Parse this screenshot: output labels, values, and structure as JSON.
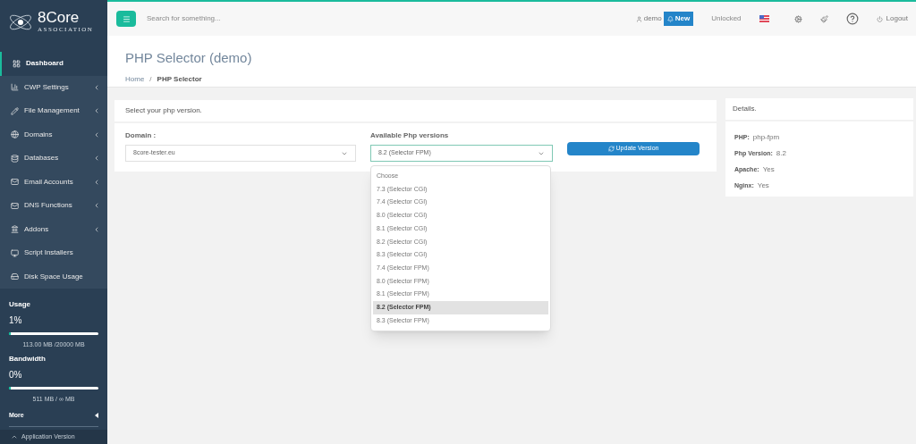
{
  "logo": {
    "name": "8Core",
    "subtitle": "ASSOCIATION"
  },
  "sidebar": {
    "items": [
      {
        "label": "Dashboard",
        "selected": true,
        "submenu": false
      },
      {
        "label": "CWP Settings",
        "selected": false,
        "submenu": true
      },
      {
        "label": "File Management",
        "selected": false,
        "submenu": true
      },
      {
        "label": "Domains",
        "selected": false,
        "submenu": true
      },
      {
        "label": "Databases",
        "selected": false,
        "submenu": true
      },
      {
        "label": "Email Accounts",
        "selected": false,
        "submenu": true
      },
      {
        "label": "DNS Functions",
        "selected": false,
        "submenu": true
      },
      {
        "label": "Addons",
        "selected": false,
        "submenu": true
      },
      {
        "label": "Script Installers",
        "selected": false,
        "submenu": false
      },
      {
        "label": "Disk Space Usage",
        "selected": false,
        "submenu": false
      }
    ],
    "usage": {
      "label": "Usage",
      "percent": "1%",
      "level": 0.01,
      "detail": "113.00 MB /20000 MB"
    },
    "bandwidth": {
      "label": "Bandwidth",
      "percent": "0%",
      "level": 0,
      "detail": "511 MB / ∞ MB"
    },
    "more": "More",
    "footer": "Application Version"
  },
  "topbar": {
    "search_placeholder": "Search for something...",
    "user": "demo",
    "badge": "New",
    "status": "Unlocked",
    "logout": "Logout"
  },
  "page": {
    "title": "PHP Selector (demo)",
    "breadcrumb": [
      "Home",
      "/",
      "PHP Selector"
    ]
  },
  "selector_card": {
    "heading": "Select your php version.",
    "domain_label": "Domain :",
    "domain_value": "8core-tester.eu",
    "versions_label": "Available Php versions",
    "versions_value": "8.2 (Selector FPM)",
    "button": "Update Version",
    "options": [
      {
        "label": "Choose",
        "selected": false
      },
      {
        "label": "7.3 (Selector CGI)",
        "selected": false
      },
      {
        "label": "7.4 (Selector CGI)",
        "selected": false
      },
      {
        "label": "8.0 (Selector CGI)",
        "selected": false
      },
      {
        "label": "8.1 (Selector CGI)",
        "selected": false
      },
      {
        "label": "8.2 (Selector CGI)",
        "selected": false
      },
      {
        "label": "8.3 (Selector CGI)",
        "selected": false
      },
      {
        "label": "7.4 (Selector FPM)",
        "selected": false
      },
      {
        "label": "8.0 (Selector FPM)",
        "selected": false
      },
      {
        "label": "8.1 (Selector FPM)",
        "selected": false
      },
      {
        "label": "8.2 (Selector FPM)",
        "selected": true
      },
      {
        "label": "8.3 (Selector FPM)",
        "selected": false
      }
    ]
  },
  "details": {
    "heading": "Details.",
    "rows": [
      {
        "key": "PHP:",
        "value": "php-fpm"
      },
      {
        "key": "Php Version:",
        "value": "8.2"
      },
      {
        "key": "Apache:",
        "value": "Yes"
      },
      {
        "key": "Nginx:",
        "value": "Yes"
      }
    ]
  }
}
